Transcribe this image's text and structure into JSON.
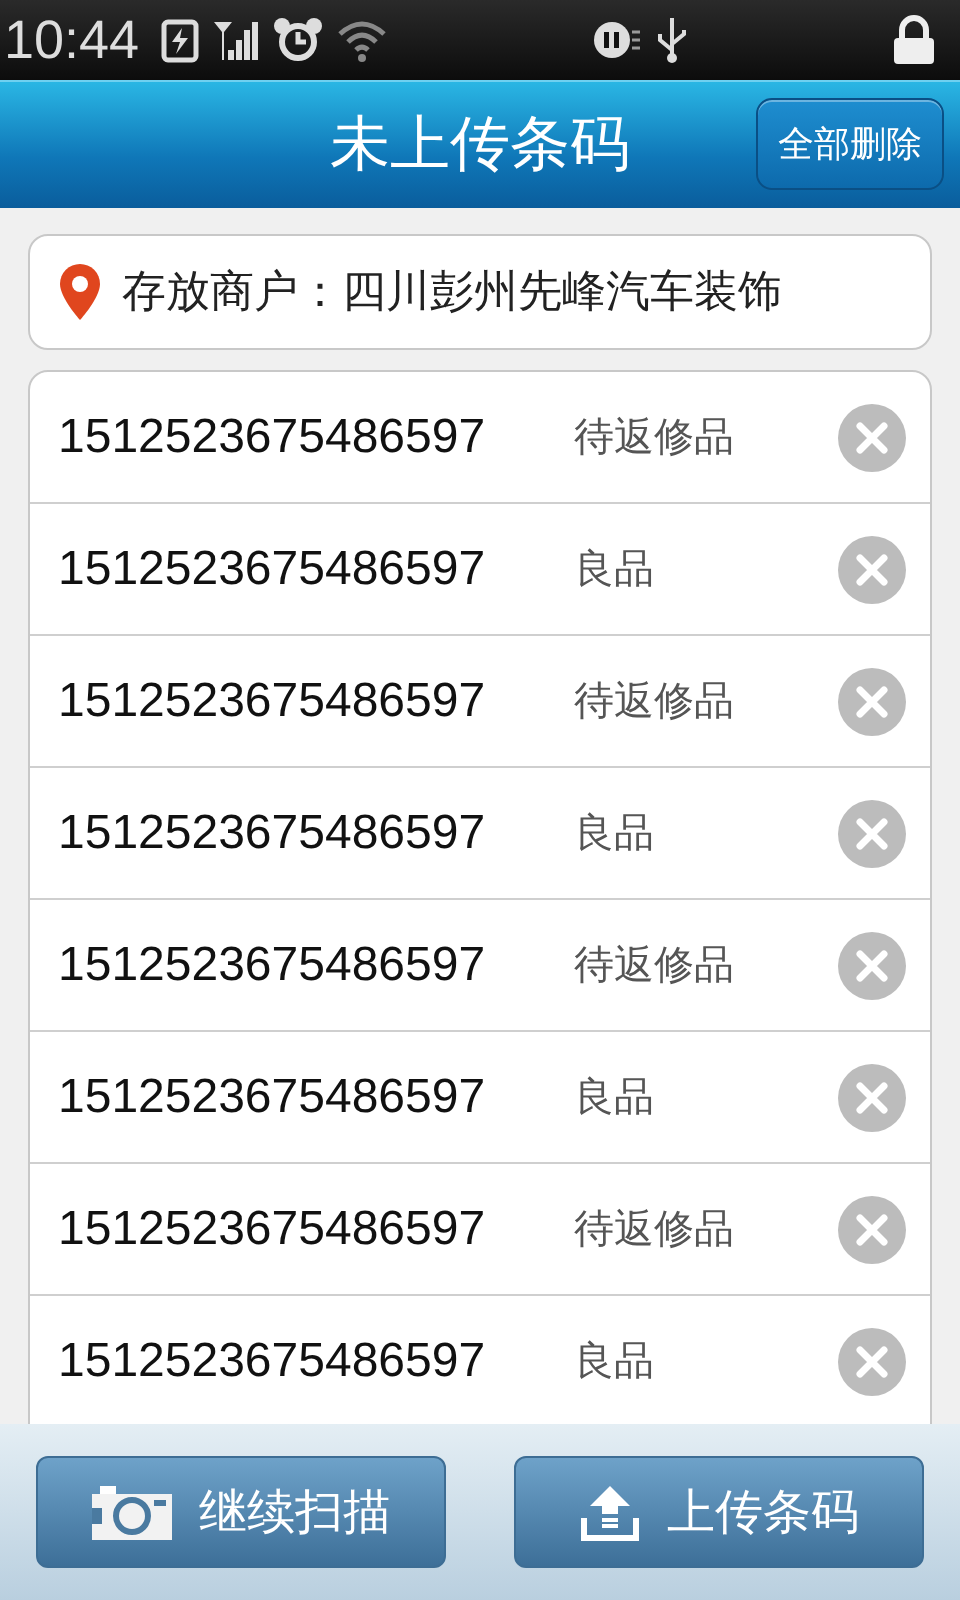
{
  "status_bar": {
    "time": "10:44"
  },
  "header": {
    "title": "未上传条码",
    "delete_all_button": "全部删除"
  },
  "merchant": {
    "label": "存放商户：",
    "value": "四川彭州先峰汽车装饰"
  },
  "items": [
    {
      "barcode": "1512523675486597",
      "status": "待返修品"
    },
    {
      "barcode": "1512523675486597",
      "status": "良品"
    },
    {
      "barcode": "1512523675486597",
      "status": "待返修品"
    },
    {
      "barcode": "1512523675486597",
      "status": "良品"
    },
    {
      "barcode": "1512523675486597",
      "status": "待返修品"
    },
    {
      "barcode": "1512523675486597",
      "status": "良品"
    },
    {
      "barcode": "1512523675486597",
      "status": "待返修品"
    },
    {
      "barcode": "1512523675486597",
      "status": "良品"
    }
  ],
  "bottom_buttons": [
    {
      "kind": "scan",
      "label": "继续扫描"
    },
    {
      "kind": "upload",
      "label": "上传条码"
    }
  ]
}
